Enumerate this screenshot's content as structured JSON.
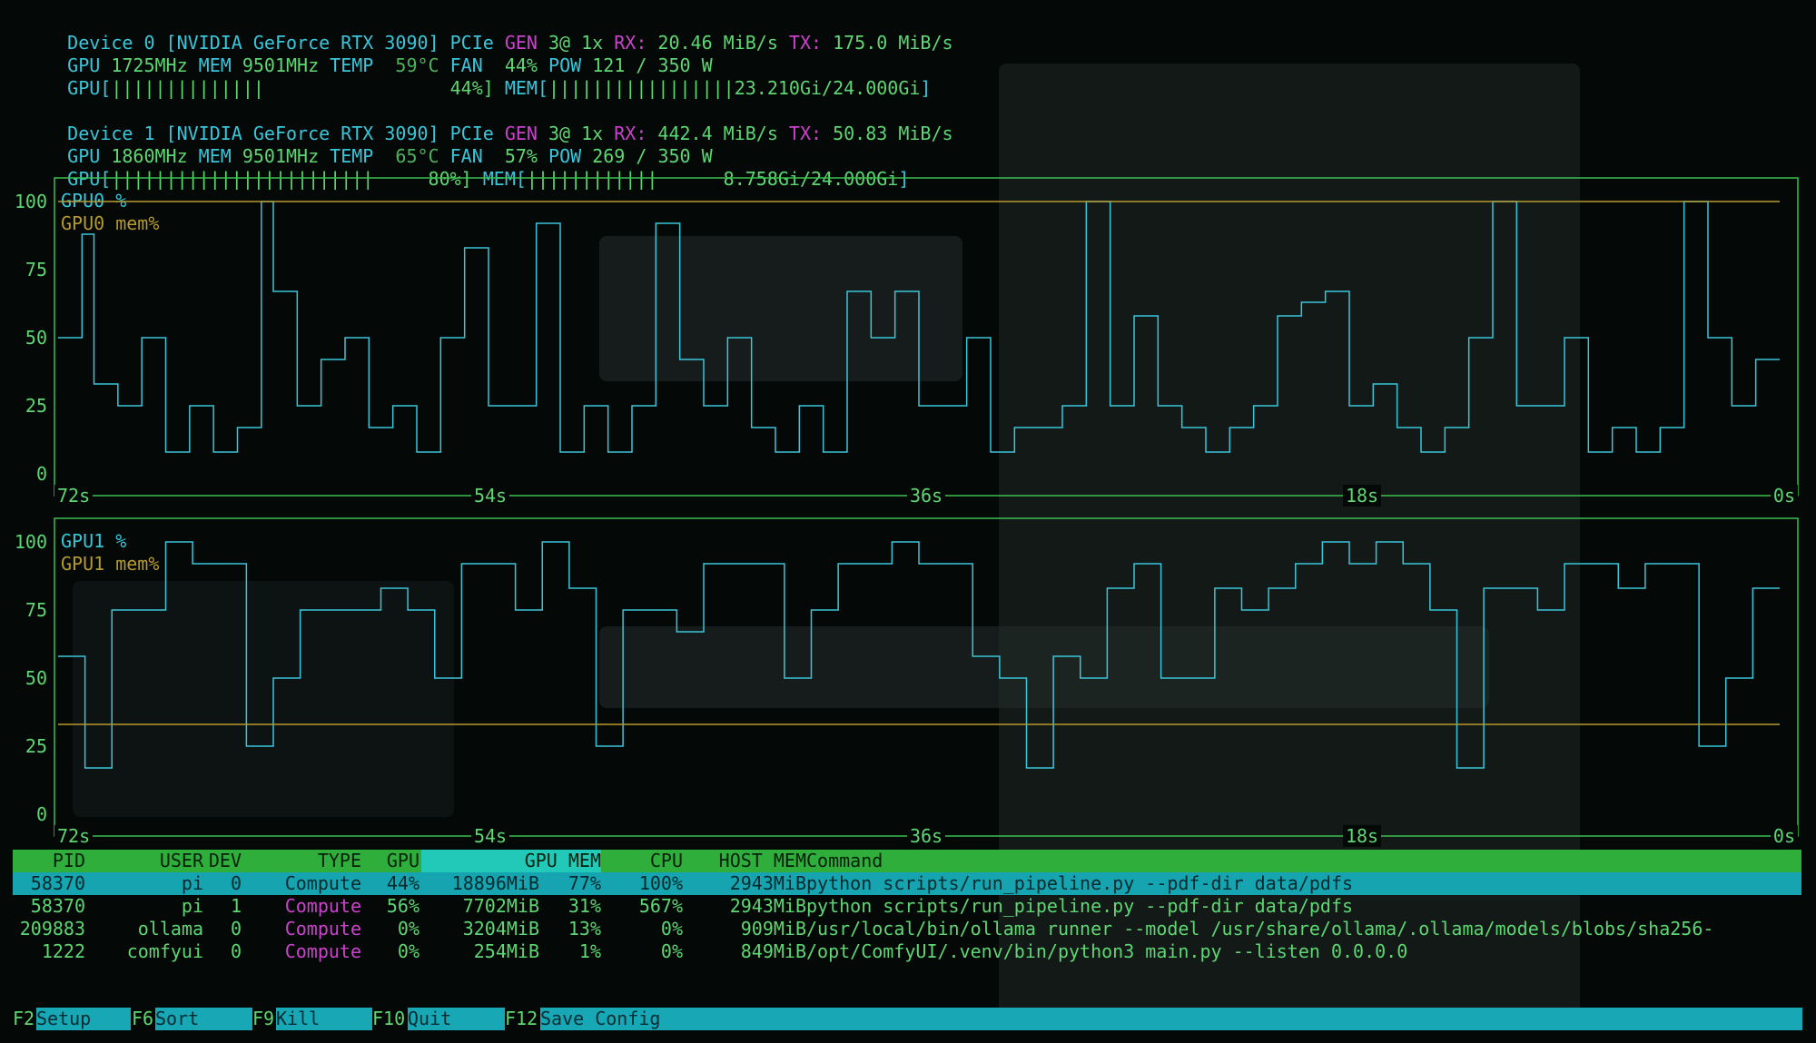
{
  "devices": [
    {
      "line1": [
        "Device 0 [NVIDIA GeForce RTX 3090] ",
        "PCIe ",
        "GEN ",
        "3@ 1x ",
        "RX: ",
        "20.46 MiB/s ",
        "TX: ",
        "175.0 MiB/s"
      ],
      "line2": [
        "GPU ",
        "1725MHz ",
        "MEM ",
        "9501MHz ",
        "TEMP  ",
        "59°C ",
        "FAN ",
        " 44% ",
        "POW ",
        "121 / 350 W"
      ],
      "line3": [
        "GPU[",
        "||||||||||||||",
        "                 44%] ",
        "MEM[",
        "|||||||||||||||||23.210Gi/24.000Gi",
        "]"
      ]
    },
    {
      "line1": [
        "Device 1 [NVIDIA GeForce RTX 3090] ",
        "PCIe ",
        "GEN ",
        "3@ 1x ",
        "RX: ",
        "442.4 MiB/s ",
        "TX: ",
        "50.83 MiB/s"
      ],
      "line2": [
        "GPU ",
        "1860MHz ",
        "MEM ",
        "9501MHz ",
        "TEMP  ",
        "65°C ",
        "FAN ",
        " 57% ",
        "POW ",
        "269 / 350 W"
      ],
      "line3": [
        "GPU[",
        "||||||||||||||||||||||||",
        "     80%] ",
        "MEM[",
        "||||||||||||      8.758Gi/24.000Gi",
        "]"
      ]
    }
  ],
  "chart_data": [
    {
      "type": "line",
      "y_ticks": [
        "100",
        "75",
        "50",
        "25",
        "0"
      ],
      "ylim": [
        0,
        100
      ],
      "x_ticks": [
        "72s",
        "54s",
        "36s",
        "18s",
        "0s"
      ],
      "series": [
        {
          "name": "GPU0 %",
          "color": "#39c6da",
          "values": [
            50,
            50,
            88,
            33,
            33,
            25,
            25,
            50,
            50,
            8,
            8,
            25,
            25,
            8,
            8,
            17,
            17,
            100,
            67,
            67,
            25,
            25,
            42,
            42,
            50,
            50,
            17,
            17,
            25,
            25,
            8,
            8,
            50,
            50,
            83,
            83,
            25,
            25,
            25,
            25,
            92,
            92,
            8,
            8,
            25,
            25,
            8,
            8,
            25,
            25,
            92,
            92,
            42,
            42,
            25,
            25,
            50,
            50,
            17,
            17,
            8,
            8,
            25,
            25,
            8,
            8,
            67,
            67,
            50,
            50,
            67,
            67,
            25,
            25,
            25,
            25,
            50,
            50,
            8,
            8,
            17,
            17,
            17,
            17,
            25,
            25,
            100,
            100,
            25,
            25,
            58,
            58,
            25,
            25,
            17,
            17,
            8,
            8,
            17,
            17,
            25,
            25,
            58,
            58,
            63,
            63,
            67,
            67,
            25,
            25,
            33,
            33,
            17,
            17,
            8,
            8,
            17,
            17,
            50,
            50,
            100,
            100,
            25,
            25,
            25,
            25,
            50,
            50,
            8,
            8,
            17,
            17,
            8,
            8,
            17,
            17,
            100,
            100,
            50,
            50,
            25,
            25,
            42,
            42
          ]
        },
        {
          "name": "GPU0 mem%",
          "color": "#b69a2e",
          "values": [
            100
          ]
        }
      ]
    },
    {
      "type": "line",
      "y_ticks": [
        "100",
        "75",
        "50",
        "25",
        "0"
      ],
      "ylim": [
        0,
        100
      ],
      "x_ticks": [
        "72s",
        "54s",
        "36s",
        "18s",
        "0s"
      ],
      "series": [
        {
          "name": "GPU1 %",
          "color": "#39c6da",
          "values": [
            58,
            58,
            17,
            17,
            75,
            75,
            75,
            75,
            100,
            100,
            92,
            92,
            92,
            92,
            25,
            25,
            50,
            50,
            75,
            75,
            75,
            75,
            75,
            75,
            83,
            83,
            75,
            75,
            50,
            50,
            92,
            92,
            92,
            92,
            75,
            75,
            100,
            100,
            83,
            83,
            25,
            25,
            75,
            75,
            75,
            75,
            67,
            67,
            92,
            92,
            92,
            92,
            92,
            92,
            50,
            50,
            75,
            75,
            92,
            92,
            92,
            92,
            100,
            100,
            92,
            92,
            92,
            92,
            58,
            58,
            50,
            50,
            17,
            17,
            58,
            58,
            50,
            50,
            83,
            83,
            92,
            92,
            50,
            50,
            50,
            50,
            83,
            83,
            75,
            75,
            83,
            83,
            92,
            92,
            100,
            100,
            92,
            92,
            100,
            100,
            92,
            92,
            75,
            75,
            17,
            17,
            83,
            83,
            83,
            83,
            75,
            75,
            92,
            92,
            92,
            92,
            83,
            83,
            92,
            92,
            92,
            92,
            25,
            25,
            50,
            50,
            83,
            83
          ]
        },
        {
          "name": "GPU1 mem%",
          "color": "#b69a2e",
          "values": [
            33
          ]
        }
      ]
    }
  ],
  "table": {
    "headers": [
      "PID",
      "USER",
      "DEV",
      "TYPE",
      "GPU",
      "GPU MEM",
      "CPU",
      "HOST MEM",
      "Command"
    ],
    "rows": [
      {
        "pid": "58370",
        "user": "pi",
        "dev": "0",
        "type": "Compute",
        "gpu": "44%",
        "gmem": "18896MiB",
        "gmemp": "77%",
        "cpu": "100%",
        "hmem": "2943MiB",
        "cmd": "python scripts/run_pipeline.py --pdf-dir data/pdfs",
        "selected": true
      },
      {
        "pid": "58370",
        "user": "pi",
        "dev": "1",
        "type": "Compute",
        "gpu": "56%",
        "gmem": "7702MiB",
        "gmemp": "31%",
        "cpu": "567%",
        "hmem": "2943MiB",
        "cmd": "python scripts/run_pipeline.py --pdf-dir data/pdfs",
        "selected": false
      },
      {
        "pid": "209883",
        "user": "ollama",
        "dev": "0",
        "type": "Compute",
        "gpu": "0%",
        "gmem": "3204MiB",
        "gmemp": "13%",
        "cpu": "0%",
        "hmem": "909MiB",
        "cmd": "/usr/local/bin/ollama runner --model /usr/share/ollama/.ollama/models/blobs/sha256-",
        "selected": false
      },
      {
        "pid": "1222",
        "user": "comfyui",
        "dev": "0",
        "type": "Compute",
        "gpu": "0%",
        "gmem": "254MiB",
        "gmemp": "1%",
        "cpu": "0%",
        "hmem": "849MiB",
        "cmd": "/opt/ComfyUI/.venv/bin/python3 main.py --listen 0.0.0.0",
        "selected": false
      }
    ]
  },
  "footer": [
    {
      "key": "F2",
      "label": "Setup"
    },
    {
      "key": "F6",
      "label": "Sort"
    },
    {
      "key": "F9",
      "label": "Kill"
    },
    {
      "key": "F10",
      "label": "Quit"
    },
    {
      "key": "F12",
      "label": "Save Config"
    }
  ]
}
